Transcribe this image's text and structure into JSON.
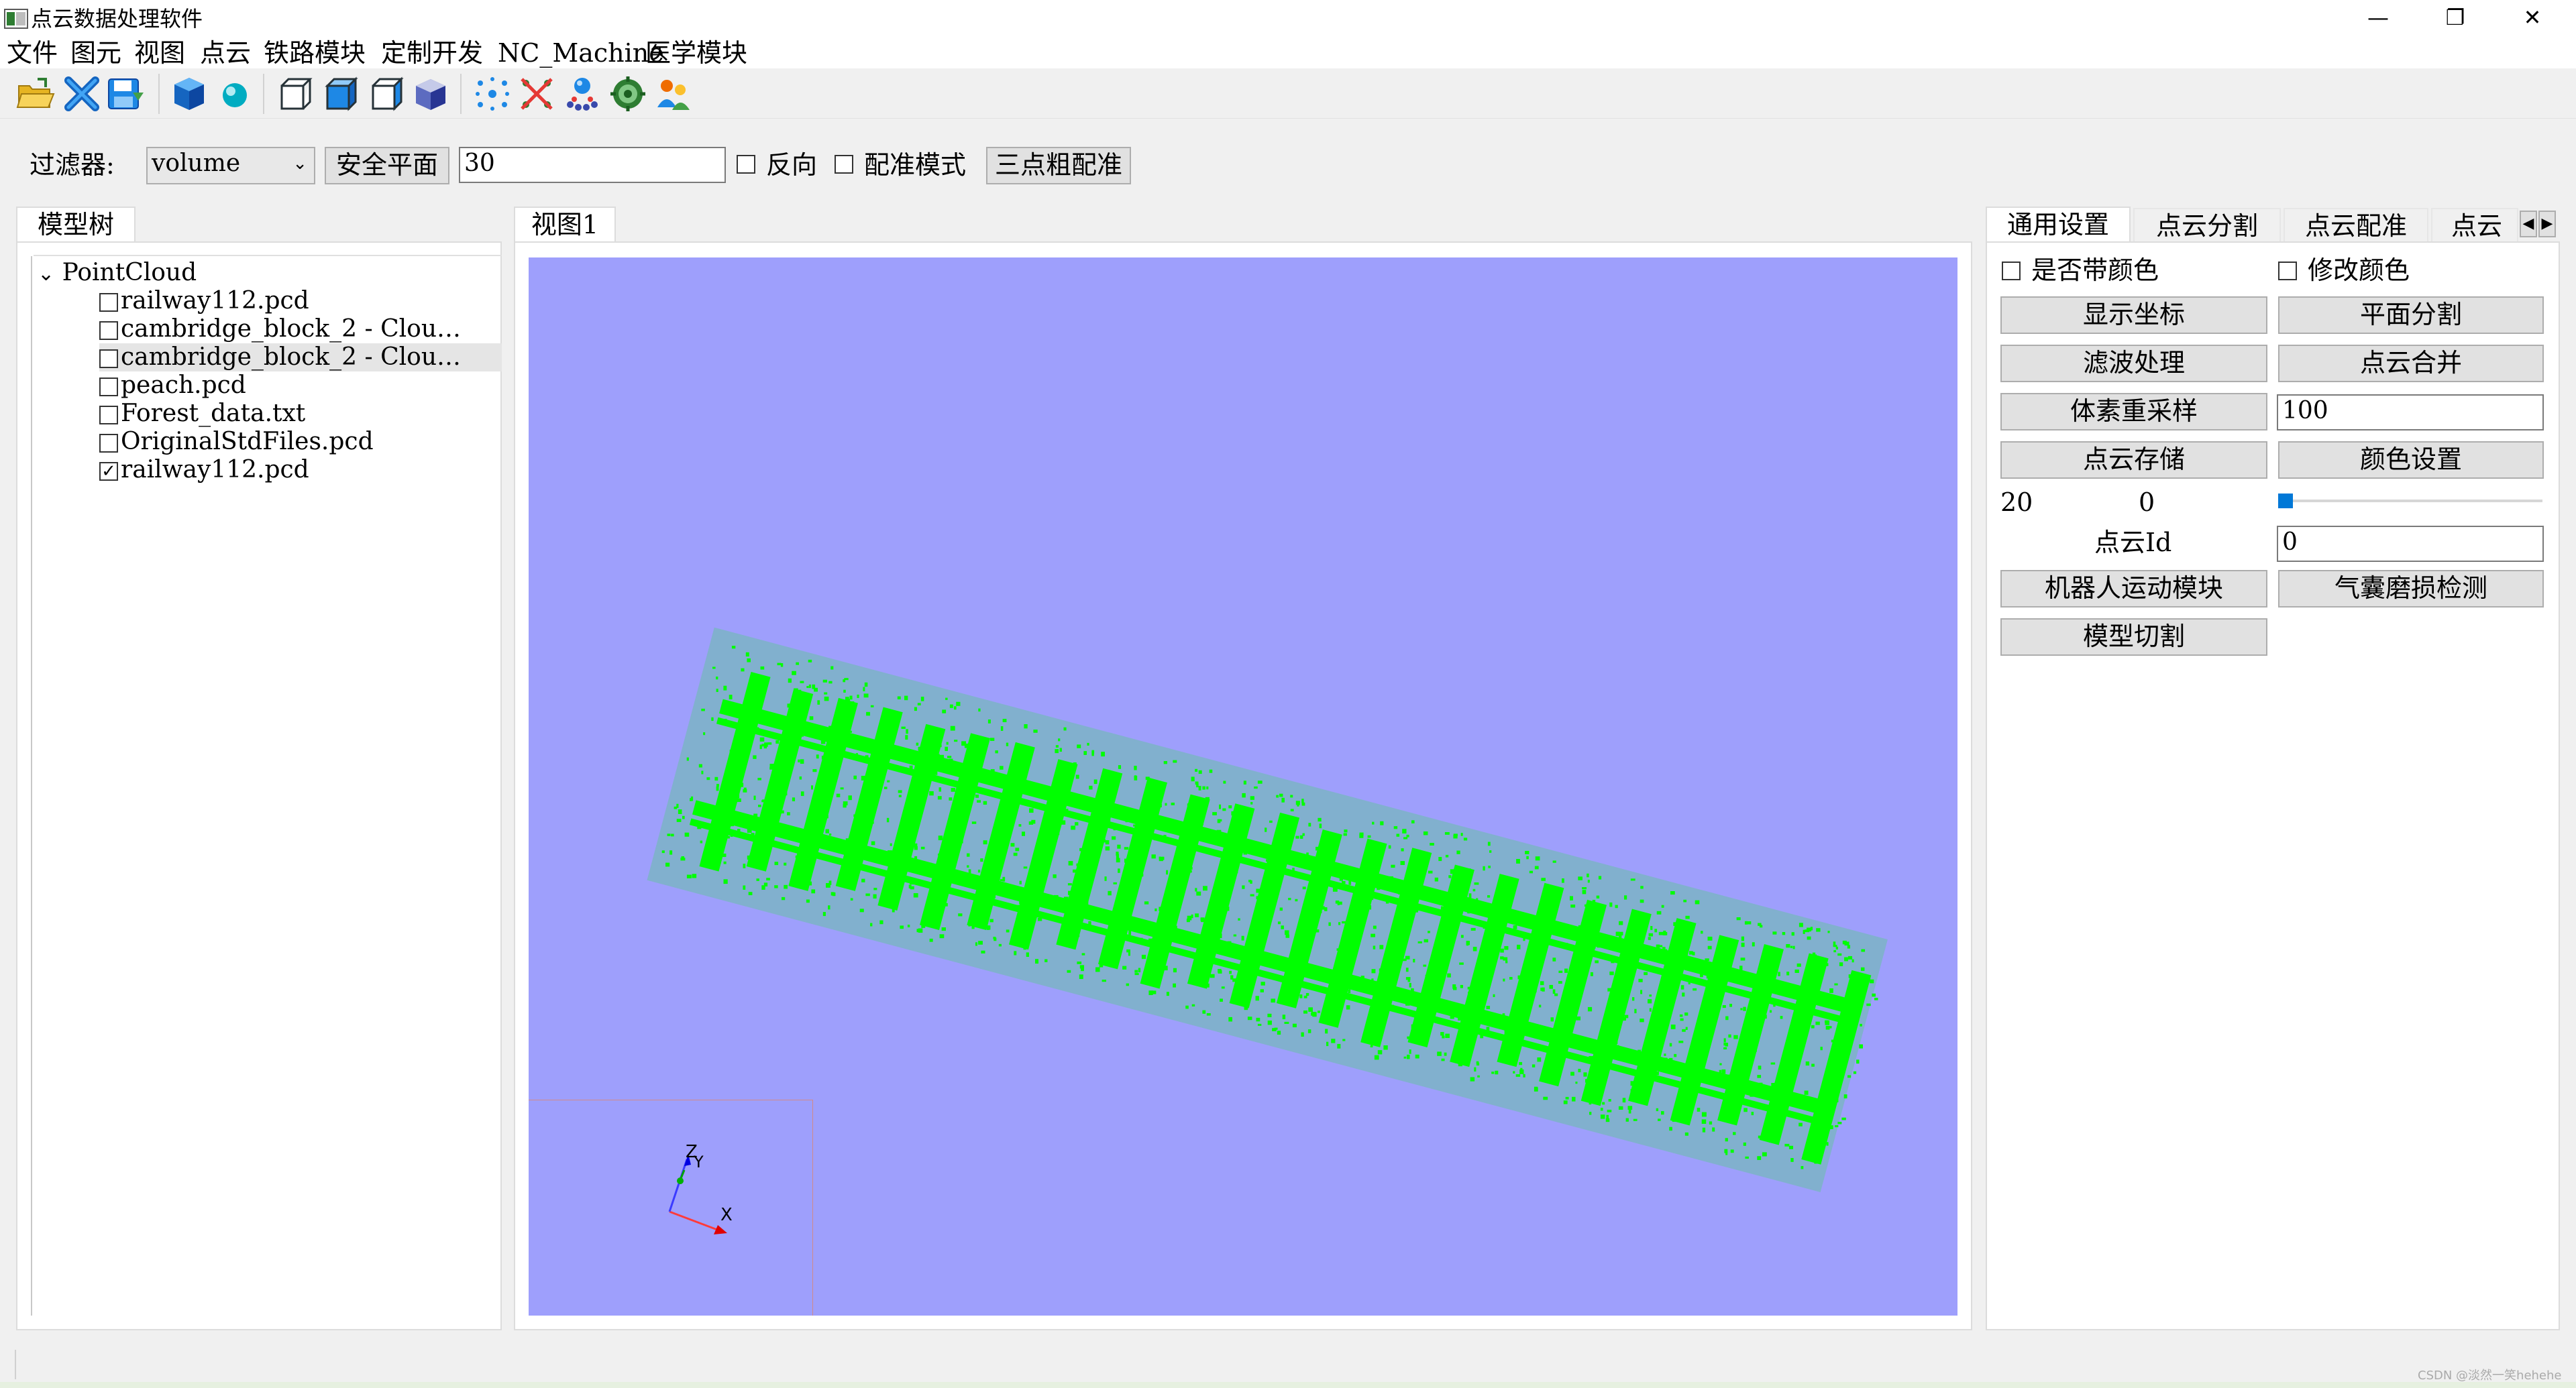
{
  "window": {
    "title": "点云数据处理软件",
    "minimize": "—",
    "restore": "❐",
    "close": "✕"
  },
  "menu": [
    "文件",
    "图元",
    "视图",
    "点云",
    "铁路模块",
    "定制开发",
    "NC_Machine",
    "医学模块"
  ],
  "toolbar": {
    "icons": [
      "open-folder-icon",
      "close-x-icon",
      "save-icon",
      "blue-cube-icon",
      "sphere-icon",
      "wire-cube-icon",
      "solid-cube-icon",
      "cube-side-icon",
      "shaded-cube-icon",
      "points-scatter-icon",
      "clear-points-icon",
      "molecule-icon",
      "gear-globe-icon",
      "people-icon"
    ]
  },
  "filter": {
    "label": "过滤器:",
    "select_value": "volume",
    "safe_plane_button": "安全平面",
    "value_input": "30",
    "reverse_label": "反向",
    "reverse_checked": false,
    "register_mode_label": "配准模式",
    "register_mode_checked": false,
    "three_point_button": "三点粗配准"
  },
  "model_tree": {
    "tab": "模型树",
    "root": "PointCloud",
    "items": [
      {
        "label": "railway112.pcd",
        "checked": false,
        "selected": false
      },
      {
        "label": "cambridge_block_2 - Clou…",
        "checked": false,
        "selected": false
      },
      {
        "label": "cambridge_block_2 - Clou…",
        "checked": false,
        "selected": true
      },
      {
        "label": "peach.pcd",
        "checked": false,
        "selected": false
      },
      {
        "label": "Forest_data.txt",
        "checked": false,
        "selected": false
      },
      {
        "label": "OriginalStdFiles.pcd",
        "checked": false,
        "selected": false
      },
      {
        "label": "railway112.pcd",
        "checked": true,
        "selected": false
      }
    ]
  },
  "view": {
    "tab": "视图1",
    "background": "#9e9ffc",
    "point_color": "#00ff00",
    "axis_labels": {
      "z": "Z",
      "y": "Y",
      "x": "X"
    }
  },
  "settings": {
    "tabs": [
      "通用设置",
      "点云分割",
      "点云配准",
      "点云"
    ],
    "has_color_label": "是否带颜色",
    "modify_color_label": "修改颜色",
    "buttons": {
      "show_axes": "显示坐标",
      "plane_segment": "平面分割",
      "filter_process": "滤波处理",
      "merge_clouds": "点云合并",
      "voxel_resample": "体素重采样",
      "save_cloud": "点云存储",
      "color_settings": "颜色设置",
      "robot_motion": "机器人运动模块",
      "airbag_wear": "气囊磨损检测",
      "model_cut": "模型切割"
    },
    "voxel_value": "100",
    "slider_max_label": "20",
    "slider_value_label": "0",
    "slider_fraction": 0.0,
    "cloud_id_label": "点云Id",
    "cloud_id_value": "0"
  },
  "watermark": "CSDN @淡然一笑hehehe"
}
